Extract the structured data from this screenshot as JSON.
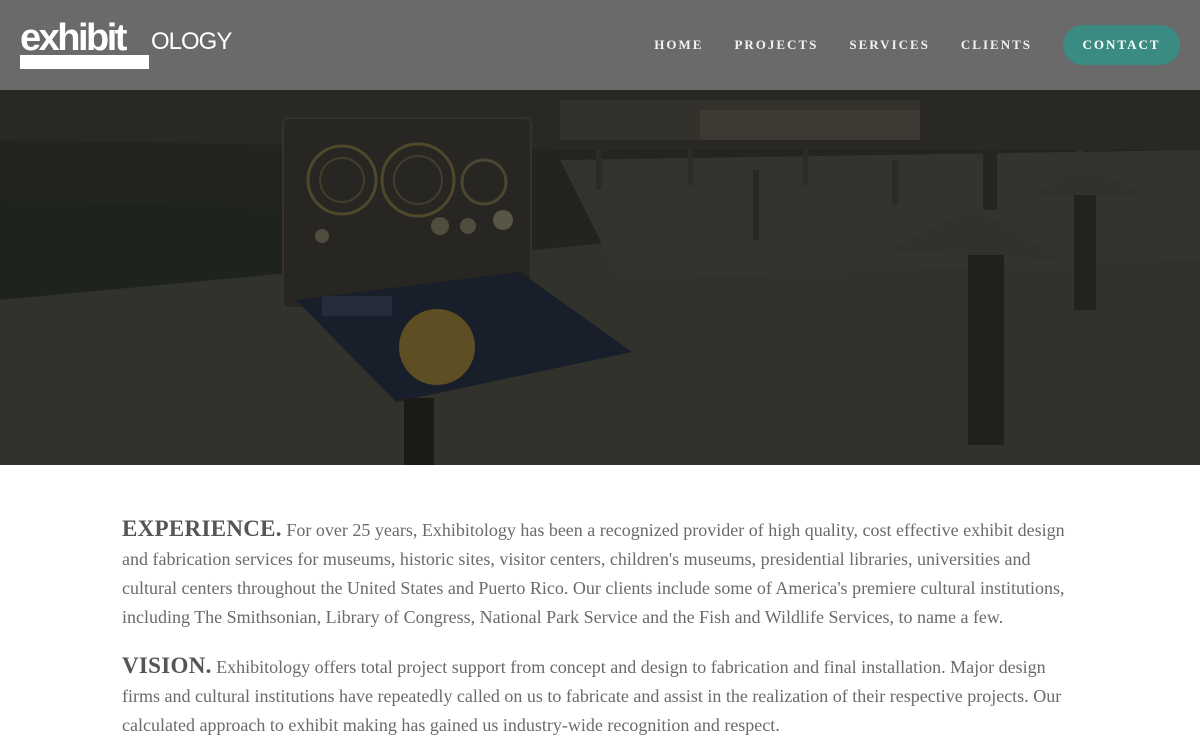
{
  "brand": {
    "logo_bold": "exhibit",
    "logo_thin": "ology"
  },
  "nav": {
    "items": [
      "HOME",
      "PROJECTS",
      "SERVICES",
      "CLIENTS"
    ],
    "contact": "CONTACT"
  },
  "colors": {
    "header_bg": "#707070",
    "contact_bg": "#3a8c83",
    "body_text": "#6a6a6a"
  },
  "sections": [
    {
      "heading": "EXPERIENCE.",
      "body": "For over 25 years, Exhibitology has been a recognized provider of high quality, cost effective exhibit design and fabrication services for museums, historic sites, visitor centers, children's museums, presidential libraries, universities and cultural centers throughout the United States and Puerto Rico. Our clients include some of America's premiere cultural institutions, including The Smithsonian, Library of Congress, National Park Service and the Fish and Wildlife Services, to name a few."
    },
    {
      "heading": "VISION.",
      "body": "Exhibitology offers total project support from concept and design to fabrication and final installation. Major design firms and cultural institutions have repeatedly called on us to fabricate and assist in the realization of their respective projects. Our calculated approach to exhibit making has gained us industry-wide recognition and respect."
    }
  ]
}
